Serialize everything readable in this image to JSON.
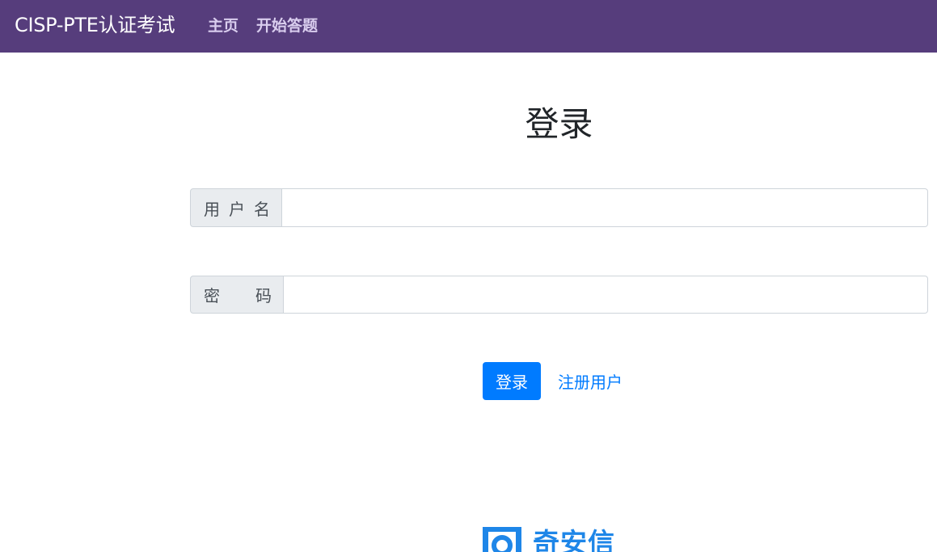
{
  "navbar": {
    "brand": "CISP-PTE认证考试",
    "links": [
      {
        "label": "主页"
      },
      {
        "label": "开始答题"
      }
    ],
    "background": "#563d7c"
  },
  "login": {
    "title": "登录",
    "username_label": [
      "用",
      "户",
      "名"
    ],
    "password_label": [
      "密",
      "码"
    ],
    "username_value": "",
    "password_value": "",
    "submit_label": "登录",
    "register_label": "注册用户",
    "accent": "#007bff"
  },
  "footer": {
    "logo_text": "奇安信",
    "logo_icon": "qianxin-logo-icon",
    "logo_color": "#1e86e8"
  }
}
